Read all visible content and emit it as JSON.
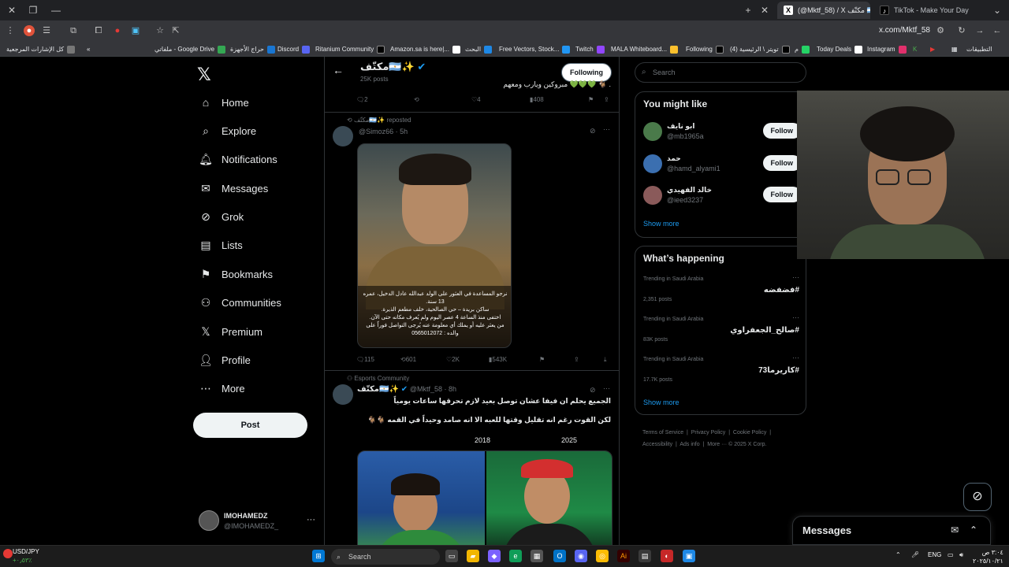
{
  "browser": {
    "tabs": [
      {
        "label": "(@Mktf_58) / X مكتّف 🇦🇷✨"
      },
      {
        "label": "TikTok - Make Your Day"
      }
    ],
    "url": "x.com/Mktf_58",
    "bookmarks": [
      "التطبيقات",
      "Instagram",
      "Today Deals",
      "م",
      "(4) تويتر \\ الرئيسية",
      "Following",
      "MALA Whiteboard...",
      "Twitch",
      "Free Vectors, Stock...",
      "البحث",
      "Amazon.sa is here|...",
      "Ritanium Community",
      "Discord",
      "حراج الأجهزة",
      "ملفاتي - Google Drive",
      "كل الإشارات المرجعية"
    ]
  },
  "nav": {
    "items": [
      {
        "label": "Home",
        "icon": "home-icon"
      },
      {
        "label": "Explore",
        "icon": "search-icon"
      },
      {
        "label": "Notifications",
        "icon": "bell-icon"
      },
      {
        "label": "Messages",
        "icon": "mail-icon"
      },
      {
        "label": "Grok",
        "icon": "grok-icon"
      },
      {
        "label": "Lists",
        "icon": "list-icon"
      },
      {
        "label": "Bookmarks",
        "icon": "bookmark-icon"
      },
      {
        "label": "Communities",
        "icon": "communities-icon"
      },
      {
        "label": "Premium",
        "icon": "x-premium-icon"
      },
      {
        "label": "Profile",
        "icon": "person-icon"
      },
      {
        "label": "More",
        "icon": "more-circle-icon"
      }
    ],
    "post_label": "Post",
    "account": {
      "name": "IMOHAMEDZ",
      "handle": "@IMOHAMEDZ_",
      "more": "···"
    }
  },
  "profile": {
    "name": "مكتّف🇦🇷✨",
    "posts": "25K posts",
    "following_label": "Following",
    "prev_text": "مبروكين ويارب ومعهم 💚💚💚 🐐 ."
  },
  "prev_actions": {
    "replies": "2",
    "likes": "4",
    "views": "408"
  },
  "tweet1": {
    "repost_by": "مكتّف🇦🇷✨ reposted",
    "handle": "@Simoz66 · 5h",
    "caption_lines": [
      "نرجو المساعدة في العثور على الولد عبدالله عادل الدخيل، عمره 13 سنة.",
      "ساكن بريدة – حي الصالحية، خلف مطعم الذيرة.",
      "اختفى منذ الساعة 4 عصر اليوم ولم يُعرف مكانه حتى الآن.",
      "من يعثر عليه أو يملك أي معلومة عنه يُرجى التواصل فوراً على والده : 0565012072"
    ],
    "replies": "115",
    "reposts": "601",
    "likes": "2K",
    "views": "543K"
  },
  "tweet2": {
    "community": "Esports Community",
    "name": "مكتّف🇦🇷✨",
    "handle": "@Mktf_58 · 8h",
    "text_line1": "الجميع يحلم ان فيفا عشان توصل بعيد لازم تحرقها ساعات يومياً",
    "text_line2": "لكن القوت رغم انه تقليل وقتها للعبه الا انه صامد وحيداً في القمه 🐐🐐",
    "year_left": "2018",
    "year_right": "2025"
  },
  "right": {
    "search_placeholder": "Search",
    "might_like_title": "You might like",
    "suggestions": [
      {
        "name": "ابو نايف",
        "handle": "@mb1965a",
        "button": "Follow"
      },
      {
        "name": "حمد",
        "handle": "@hamd_alyami1",
        "button": "Follow"
      },
      {
        "name": "خالد الفهيدي",
        "handle": "@ieed3237",
        "button": "Follow"
      }
    ],
    "show_more": "Show more",
    "happening_title": "What’s happening",
    "trends": [
      {
        "location": "Trending in Saudi Arabia",
        "tag": "#فضفضه",
        "posts": "2,351 posts"
      },
      {
        "location": "Trending in Saudi Arabia",
        "tag": "#صالح_الجعفراوي",
        "posts": "83K posts"
      },
      {
        "location": "Trending in Saudi Arabia",
        "tag": "#كاريرما73",
        "posts": "17.7K posts"
      }
    ],
    "show_more2": "Show more",
    "footer": [
      "Terms of Service",
      "Privacy Policy",
      "Cookie Policy",
      "Accessibility",
      "Ads info",
      "More ···",
      "© 2025 X Corp."
    ]
  },
  "messages_drawer": {
    "title": "Messages"
  },
  "taskbar": {
    "ticker_pair": "USD/JPY",
    "ticker_change": "+٠٫٥٣٪",
    "search_label": "Search",
    "lang": "ENG",
    "time": "٣:٠٤ ص",
    "date": "٢٠٢٥/١٠/٢١"
  }
}
